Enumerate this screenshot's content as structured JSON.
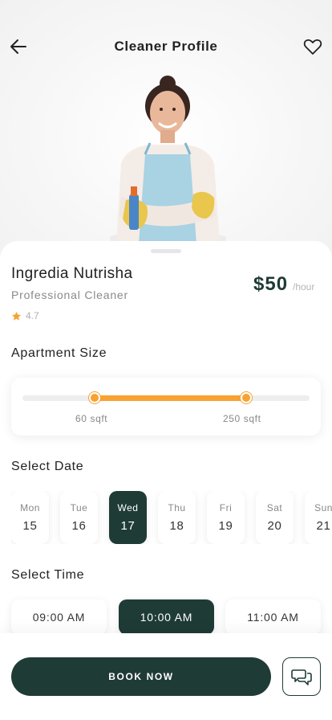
{
  "header": {
    "title": "Cleaner Profile",
    "back_icon": "arrow-left-icon",
    "favorite_icon": "heart-icon"
  },
  "profile": {
    "name": "Ingredia Nutrisha",
    "role": "Professional Cleaner",
    "rating": "4.7",
    "rating_icon": "star-icon",
    "price": "$50",
    "price_unit": "/hour"
  },
  "apartment_size": {
    "label": "Apartment Size",
    "min_label": "60 sqft",
    "max_label": "250 sqft",
    "range_start_fraction": 0.25,
    "range_end_fraction": 0.78
  },
  "date": {
    "label": "Select Date",
    "days": [
      {
        "name": "Mon",
        "num": "15",
        "selected": false
      },
      {
        "name": "Tue",
        "num": "16",
        "selected": false
      },
      {
        "name": "Wed",
        "num": "17",
        "selected": true
      },
      {
        "name": "Thu",
        "num": "18",
        "selected": false
      },
      {
        "name": "Fri",
        "num": "19",
        "selected": false
      },
      {
        "name": "Sat",
        "num": "20",
        "selected": false
      },
      {
        "name": "Sun",
        "num": "21",
        "selected": false
      }
    ]
  },
  "time": {
    "label": "Select Time",
    "slots": [
      {
        "label": "09:00 AM",
        "selected": false
      },
      {
        "label": "10:00 AM",
        "selected": true
      },
      {
        "label": "11:00 AM",
        "selected": false
      }
    ]
  },
  "actions": {
    "book_label": "BOOK NOW",
    "chat_icon": "chat-bubbles-icon"
  },
  "colors": {
    "primary": "#1f3b36",
    "accent": "#f7a233",
    "muted": "#8a8a8a"
  }
}
